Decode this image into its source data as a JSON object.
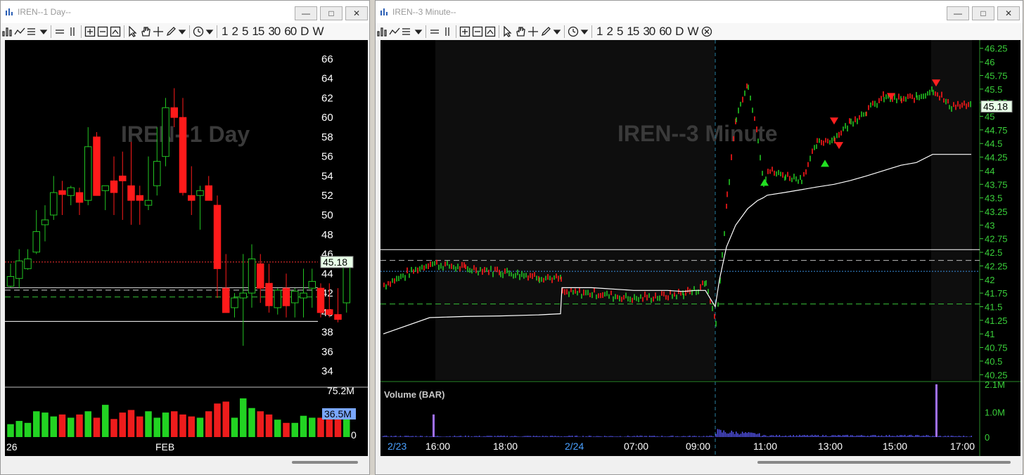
{
  "windows": {
    "daily": {
      "title": "IREN--1 Day--",
      "watermark": "IREN--1 Day",
      "price_label": "45.18",
      "volume_label_top": "75.2M",
      "volume_current": "36.5M",
      "volume_zero": "0",
      "x_labels": [
        "26",
        "FEB"
      ]
    },
    "minute": {
      "title": "IREN--3 Minute--",
      "watermark": "IREN--3 Minute",
      "price_label": "45.18",
      "volume_title": "Volume (BAR)",
      "volume_labels": [
        "2.1M",
        "1.0M",
        "0"
      ],
      "x_labels": [
        "2/23",
        "16:00",
        "18:00",
        "2/24",
        "07:00",
        "09:00",
        "11:00",
        "13:00",
        "15:00",
        "17:00"
      ]
    }
  },
  "toolbar": {
    "timeframes": [
      "1",
      "2",
      "5",
      "15",
      "30",
      "60",
      "D",
      "W"
    ]
  },
  "chart_data": [
    {
      "type": "candlestick",
      "title": "IREN--1 Day",
      "y_ticks": [
        66,
        64,
        62,
        60,
        58,
        56,
        54,
        52,
        50,
        48,
        46,
        44,
        42,
        40,
        38,
        36,
        34
      ],
      "ylim": [
        32.5,
        67.5
      ],
      "last_price": 45.18,
      "candles": [
        [
          42.7,
          45,
          42.6,
          43.7
        ],
        [
          43.5,
          46.5,
          42.5,
          45.3
        ],
        [
          44.5,
          46.5,
          44.4,
          45.5
        ],
        [
          46.2,
          50.5,
          46,
          48.3
        ],
        [
          49,
          51,
          47.3,
          49.5
        ],
        [
          50,
          54,
          49.5,
          52.3
        ],
        [
          52.5,
          53.5,
          50,
          52.1
        ],
        [
          52,
          53,
          51,
          52.8
        ],
        [
          52.3,
          52.8,
          50,
          51.3
        ],
        [
          51.5,
          59,
          51,
          57
        ],
        [
          58,
          58.5,
          52,
          52
        ],
        [
          52.5,
          53,
          50.5,
          53
        ],
        [
          53.5,
          56,
          50,
          52.3
        ],
        [
          54,
          56.5,
          49.5,
          53.5
        ],
        [
          53,
          57.5,
          49,
          51.5
        ],
        [
          52,
          53,
          49,
          51.5
        ],
        [
          51,
          56,
          50.5,
          51.5
        ],
        [
          53,
          59,
          52,
          55.5
        ],
        [
          56,
          62,
          55,
          61
        ],
        [
          61,
          63,
          59,
          60
        ],
        [
          60,
          62,
          52,
          52.3
        ],
        [
          52,
          55,
          50,
          51.5
        ],
        [
          52,
          53,
          48.5,
          52.5
        ],
        [
          53,
          54,
          52,
          51.5
        ],
        [
          51,
          52,
          41.5,
          44.5
        ],
        [
          42.5,
          46,
          40,
          40
        ],
        [
          40.5,
          42,
          39.5,
          41.5
        ],
        [
          41.5,
          46,
          36.6,
          42
        ],
        [
          42,
          47,
          40.5,
          45.5
        ],
        [
          45,
          46,
          41,
          42.5
        ],
        [
          43,
          45,
          40,
          40.7
        ],
        [
          40.5,
          42.5,
          39.8,
          42.3
        ],
        [
          42.5,
          44,
          39.5,
          40.7
        ],
        [
          41,
          42.5,
          39.5,
          42.2
        ],
        [
          41.5,
          44.5,
          39.5,
          42
        ],
        [
          42.5,
          44.5,
          40.5,
          43.2
        ],
        [
          42.5,
          43,
          39.5,
          40
        ],
        [
          40.3,
          43,
          39.5,
          39.8
        ],
        [
          39.8,
          42.5,
          39,
          39.3
        ],
        [
          41,
          45.5,
          40,
          45.18
        ]
      ],
      "volume": [
        20,
        25,
        22,
        40,
        38,
        32,
        35,
        30,
        35,
        40,
        30,
        50,
        28,
        38,
        42,
        32,
        40,
        30,
        38,
        40,
        35,
        32,
        30,
        40,
        52,
        55,
        30,
        60,
        45,
        40,
        35,
        27,
        22,
        22,
        33,
        30,
        30,
        40,
        30,
        34
      ],
      "volume_max_label": "75.2M",
      "volume_current_label": "36.5M",
      "horizontal_lines": [
        {
          "price": 45.18,
          "style": "dotted",
          "color": "#ff3030"
        },
        {
          "price": 42.55,
          "style": "solid",
          "color": "#cfcfcf"
        },
        {
          "price": 42.3,
          "style": "dashed",
          "color": "#cfcfcf"
        },
        {
          "price": 41.6,
          "style": "dashed",
          "color": "#38c038"
        },
        {
          "price": 39.1,
          "style": "solid",
          "color": "#ffffff"
        }
      ]
    },
    {
      "type": "line",
      "title": "IREN--3 Minute",
      "y_ticks": [
        46.25,
        46,
        45.75,
        45.5,
        45.25,
        45,
        44.75,
        44.5,
        44.25,
        44,
        43.75,
        43.5,
        43.25,
        43,
        42.75,
        42.5,
        42.25,
        42,
        41.75,
        41.5,
        41.25,
        41,
        40.75,
        40.5,
        40.25
      ],
      "ylim": [
        40.15,
        46.35
      ],
      "last_price": 45.18,
      "x": [
        "2/23 15:00",
        "2/23 16:00",
        "2/23 17:00",
        "2/23 18:00",
        "2/23 19:00",
        "2/23 19:30",
        "2/24 04:00",
        "2/24 06:00",
        "2/24 07:00",
        "2/24 08:00",
        "2/24 08:30",
        "2/24 09:00",
        "2/24 09:15",
        "2/24 09:30",
        "2/24 09:35",
        "2/24 09:45",
        "2/24 10:00",
        "2/24 10:15",
        "2/24 10:30",
        "2/24 10:45",
        "2/24 11:00",
        "2/24 11:30",
        "2/24 12:00",
        "2/24 12:30",
        "2/24 13:00",
        "2/24 13:30",
        "2/24 14:00",
        "2/24 14:30",
        "2/24 15:00",
        "2/24 15:30",
        "2/24 16:00",
        "2/24 16:30",
        "2/24 17:00"
      ],
      "price": [
        41.9,
        42.3,
        42.2,
        42.15,
        42.05,
        42,
        41.75,
        41.75,
        41.65,
        41.7,
        41.75,
        41.8,
        41.95,
        41.2,
        42,
        43.5,
        45,
        45.6,
        44.6,
        43.8,
        44,
        43.9,
        43.85,
        44.5,
        44.6,
        44.9,
        45.1,
        45.35,
        45.3,
        45.35,
        45.5,
        45.2,
        45.18
      ],
      "vwap": [
        41.0,
        41.3,
        41.32,
        41.33,
        41.35,
        41.37,
        41.85,
        41.85,
        41.8,
        41.8,
        41.78,
        41.8,
        41.8,
        41.5,
        42,
        42.6,
        43,
        43.3,
        43.45,
        43.5,
        43.55,
        43.6,
        43.65,
        43.7,
        43.75,
        43.82,
        43.9,
        44.0,
        44.1,
        44.15,
        44.3,
        44.3,
        44.3
      ],
      "horizontal_lines": [
        {
          "price": 42.55,
          "style": "solid",
          "color": "#ffffff"
        },
        {
          "price": 42.35,
          "style": "dashed",
          "color": "#bbbbbb"
        },
        {
          "price": 42.15,
          "style": "dotted",
          "color": "#3a8fe0"
        },
        {
          "price": 41.55,
          "style": "dashed",
          "color": "#38c038"
        }
      ],
      "markers": [
        {
          "x": "2/24 10:50",
          "price": 43.8,
          "type": "buy"
        },
        {
          "x": "2/24 12:45",
          "price": 44.15,
          "type": "buy"
        },
        {
          "x": "2/24 13:00",
          "price": 44.9,
          "type": "sell"
        },
        {
          "x": "2/24 13:10",
          "price": 44.45,
          "type": "sell"
        },
        {
          "x": "2/24 14:45",
          "price": 45.35,
          "type": "sell"
        },
        {
          "x": "2/24 16:05",
          "price": 45.6,
          "type": "sell"
        }
      ],
      "volume": {
        "labels": [
          "2.1M",
          "1.0M",
          "0"
        ],
        "max": 2.1,
        "spikes": [
          {
            "x": "2/23 16:00",
            "value": 0.9
          },
          {
            "x": "2/24 16:00",
            "value": 2.1
          }
        ]
      }
    }
  ]
}
